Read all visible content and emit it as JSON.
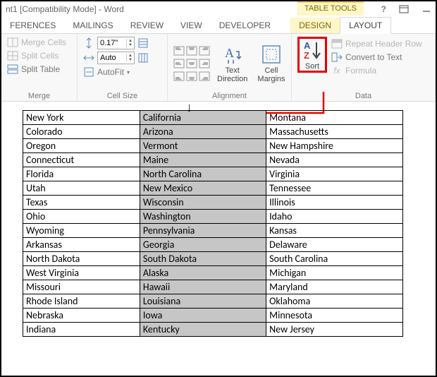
{
  "title": "nt1 [Compatibility Mode] - Word",
  "table_tools_label": "TABLE TOOLS",
  "tabs": {
    "references": "FERENCES",
    "mailings": "MAILINGS",
    "review": "REVIEW",
    "view": "VIEW",
    "developer": "DEVELOPER",
    "design": "DESIGN",
    "layout": "LAYOUT"
  },
  "ribbon": {
    "merge": {
      "merge_cells": "Merge Cells",
      "split_cells": "Split Cells",
      "split_table": "Split Table",
      "group": "Merge"
    },
    "cellsize": {
      "height": "0.17\"",
      "width": "Auto",
      "autofit": "AutoFit",
      "group": "Cell Size"
    },
    "alignment": {
      "text_direction": "Text Direction",
      "cell_margins": "Cell Margins",
      "group": "Alignment"
    },
    "data": {
      "sort": "Sort",
      "repeat_header": "Repeat Header Row",
      "convert_text": "Convert to Text",
      "formula": "Formula",
      "group": "Data"
    }
  },
  "table": {
    "rows": [
      [
        "New York",
        "California",
        "Montana"
      ],
      [
        "Colorado",
        "Arizona",
        "Massachusetts"
      ],
      [
        "Oregon",
        "Vermont",
        "New Hampshire"
      ],
      [
        "Connecticut",
        "Maine",
        "Nevada"
      ],
      [
        "Florida",
        "North Carolina",
        "Virginia"
      ],
      [
        "Utah",
        "New Mexico",
        "Tennessee"
      ],
      [
        "Texas",
        "Wisconsin",
        "Illinois"
      ],
      [
        "Ohio",
        "Washington",
        "Idaho"
      ],
      [
        "Wyoming",
        "Pennsylvania",
        "Kansas"
      ],
      [
        "Arkansas",
        "Georgia",
        "Delaware"
      ],
      [
        "North Dakota",
        "South Dakota",
        "South Carolina"
      ],
      [
        "West Virginia",
        "Alaska",
        "Michigan"
      ],
      [
        "Missouri",
        "Hawaii",
        "Maryland"
      ],
      [
        "Rhode Island",
        "Louisiana",
        "Oklahoma"
      ],
      [
        "Nebraska",
        "Iowa",
        "Minnesota"
      ],
      [
        "Indiana",
        "Kentucky",
        "New Jersey"
      ]
    ]
  }
}
